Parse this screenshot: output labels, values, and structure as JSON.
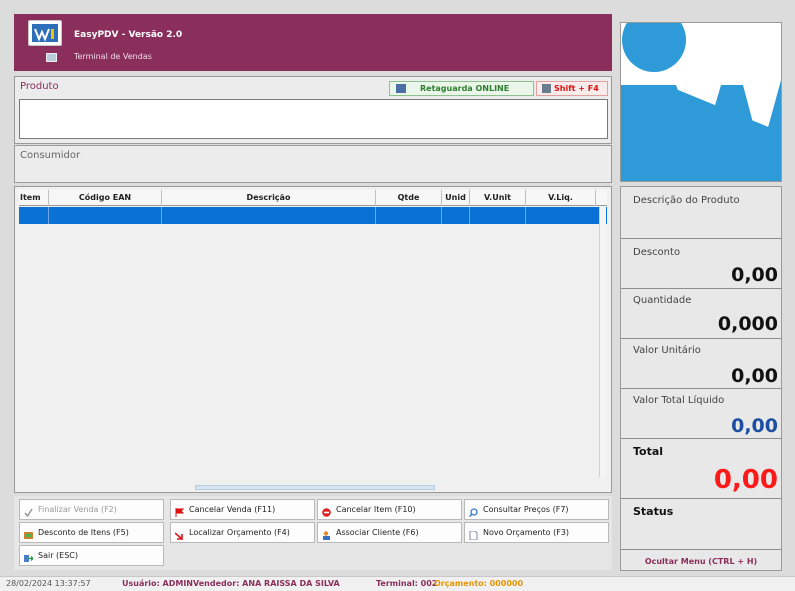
{
  "header": {
    "title": "EasyPDV - Versão 2.0",
    "subtitle": "Terminal de Vendas"
  },
  "produto": {
    "label": "Produto",
    "value": "",
    "status_online": "Retaguarda ONLINE",
    "shortcut": "Shift + F4"
  },
  "consumidor": {
    "label": "Consumidor"
  },
  "grid": {
    "columns": [
      "Item",
      "Código EAN",
      "Descrição",
      "Qtde",
      "Unid",
      "V.Unit",
      "V.Liq."
    ],
    "rows": []
  },
  "buttons": [
    {
      "label": "Finalizar Venda (F2)",
      "icon": "check-icon",
      "enabled": false
    },
    {
      "label": "Cancelar Venda (F11)",
      "icon": "red-flag-icon",
      "enabled": true
    },
    {
      "label": "Cancelar Item (F10)",
      "icon": "stop-icon",
      "enabled": true
    },
    {
      "label": "Consultar Preços (F7)",
      "icon": "search-icon",
      "enabled": true
    },
    {
      "label": "Desconto de Itens (F5)",
      "icon": "discount-icon",
      "enabled": true
    },
    {
      "label": "Localizar Orçamento (F4)",
      "icon": "arrow-icon",
      "enabled": true
    },
    {
      "label": "Associar Cliente (F6)",
      "icon": "user-icon",
      "enabled": true
    },
    {
      "label": "Novo Orçamento (F3)",
      "icon": "document-icon",
      "enabled": true
    },
    {
      "label": "Sair (ESC)",
      "icon": "exit-icon",
      "enabled": true
    }
  ],
  "right": {
    "descricao_label": "Descrição do Produto",
    "desconto_label": "Desconto",
    "desconto_value": "0,00",
    "quantidade_label": "Quantidade",
    "quantidade_value": "0,000",
    "valor_unitario_label": "Valor Unitário",
    "valor_unitario_value": "0,00",
    "valor_total_label": "Valor Total Líquido",
    "valor_total_value": "0,00",
    "total_label": "Total",
    "total_value": "0,00",
    "status_label": "Status",
    "ocultar_menu": "Ocultar Menu (CTRL + H)"
  },
  "statusbar": {
    "datetime": "28/02/2024 13:37:57",
    "usuario": "Usuário: ADMIN",
    "vendedor": "Vendedor: ANA RAISSA DA SILVA",
    "terminal": "Terminal: 002",
    "orcamento": "Orçamento: 000000"
  },
  "colors": {
    "header": "#8a2f5b",
    "selection": "#0b72d5",
    "logo_blue": "#2e9ad8",
    "total_red": "#ff1a1a",
    "valor_total_blue": "#1c4fa3",
    "orcamento_orange": "#e69500"
  }
}
